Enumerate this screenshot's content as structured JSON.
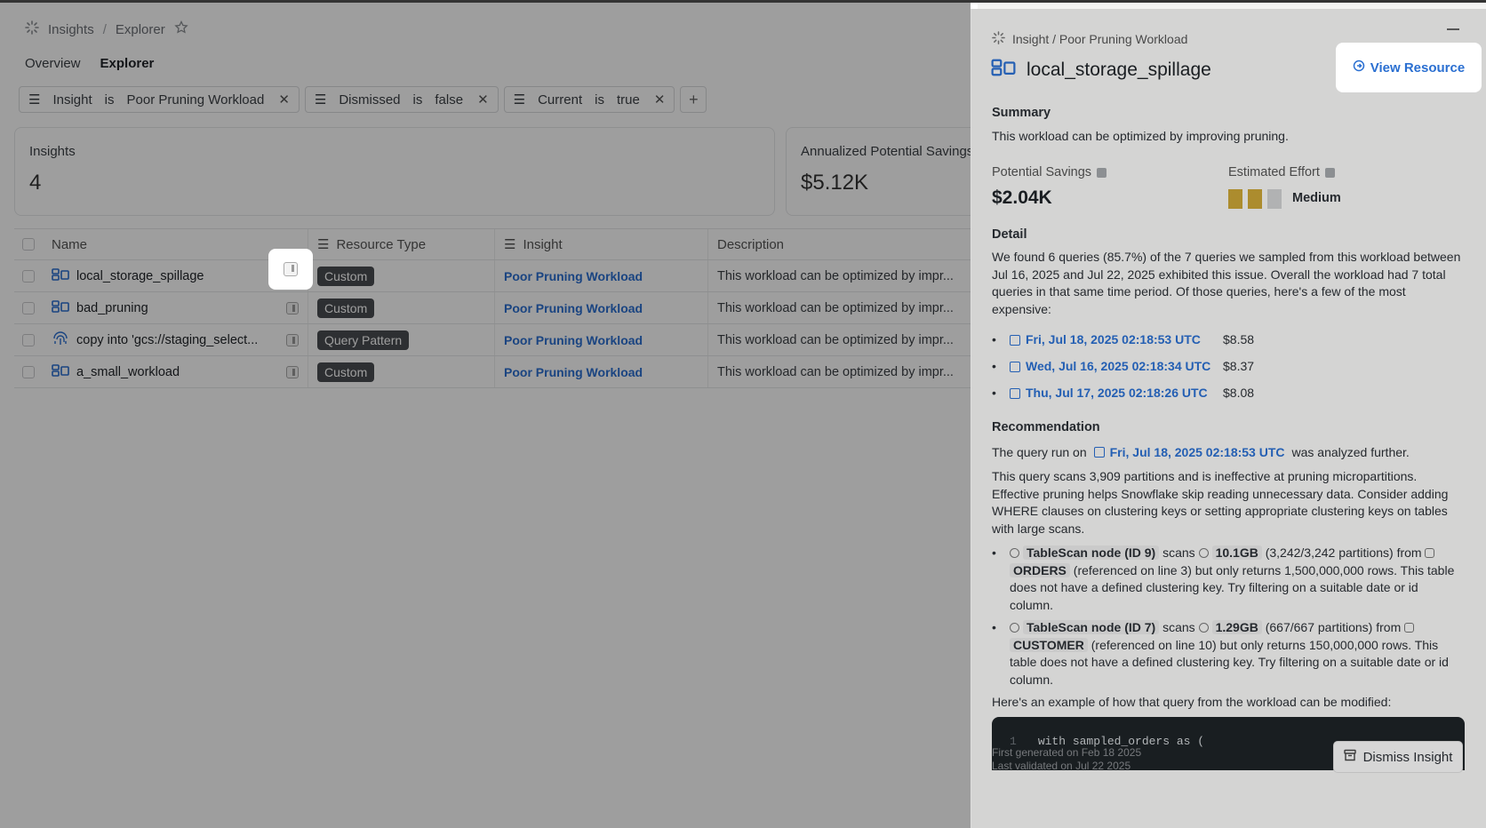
{
  "breadcrumb": {
    "root": "Insights",
    "current": "Explorer"
  },
  "tabs": [
    {
      "label": "Overview"
    },
    {
      "label": "Explorer"
    }
  ],
  "filters": [
    {
      "field": "Insight",
      "op": "is",
      "value": "Poor Pruning Workload"
    },
    {
      "field": "Dismissed",
      "op": "is",
      "value": "false"
    },
    {
      "field": "Current",
      "op": "is",
      "value": "true"
    }
  ],
  "cards": {
    "insights": {
      "label": "Insights",
      "value": "4"
    },
    "savings": {
      "label": "Annualized Potential Savings",
      "value": "$5.12K"
    }
  },
  "table": {
    "headers": {
      "name": "Name",
      "type": "Resource Type",
      "insight": "Insight",
      "desc": "Description"
    },
    "rows": [
      {
        "name": "local_storage_spillage",
        "type": "Custom",
        "insight": "Poor Pruning Workload",
        "desc": "This workload can be optimized by impr..."
      },
      {
        "name": "bad_pruning",
        "type": "Custom",
        "insight": "Poor Pruning Workload",
        "desc": "This workload can be optimized by impr..."
      },
      {
        "name": "copy into 'gcs://staging_select...",
        "type": "Query Pattern",
        "insight": "Poor Pruning Workload",
        "desc": "This workload can be optimized by impr..."
      },
      {
        "name": "a_small_workload",
        "type": "Custom",
        "insight": "Poor Pruning Workload",
        "desc": "This workload can be optimized by impr..."
      }
    ]
  },
  "drawer": {
    "breadcrumb": "Insight / Poor Pruning Workload",
    "title": "local_storage_spillage",
    "view_resource": "View Resource",
    "summary_h": "Summary",
    "summary": "This workload can be optimized by improving pruning.",
    "savings_label": "Potential Savings",
    "savings_value": "$2.04K",
    "effort_label": "Estimated Effort",
    "effort_value": "Medium",
    "effort_level": 2,
    "detail_h": "Detail",
    "detail": "We found 6 queries (85.7%) of the 7 queries we sampled from this workload between Jul 16, 2025 and Jul 22, 2025 exhibited this issue. Overall the workload had 7 total queries in that same time period. Of those queries, here's a few of the most expensive:",
    "queries": [
      {
        "time": "Fri, Jul 18, 2025 02:18:53 UTC",
        "cost": "$8.58"
      },
      {
        "time": "Wed, Jul 16, 2025 02:18:34 UTC",
        "cost": "$8.37"
      },
      {
        "time": "Thu, Jul 17, 2025 02:18:26 UTC",
        "cost": "$8.08"
      }
    ],
    "rec_h": "Recommendation",
    "rec_prefix": "The query run on",
    "rec_link": "Fri, Jul 18, 2025 02:18:53 UTC",
    "rec_suffix": "was analyzed further.",
    "rec_para": "This query scans 3,909 partitions and is ineffective at pruning micropartitions. Effective pruning helps Snowflake skip reading unnecessary data. Consider adding WHERE clauses on clustering keys or setting appropriate clustering keys on tables with large scans.",
    "scans": [
      {
        "node": "TableScan node (ID 9)",
        "scans": "scans",
        "size": "10.1GB",
        "parts": "(3,242/3,242 partitions) from",
        "table": "ORDERS",
        "rest": "(referenced on line 3) but only returns 1,500,000,000 rows. This table does not have a defined clustering key. Try filtering on a suitable date or id column."
      },
      {
        "node": "TableScan node (ID 7)",
        "scans": "scans",
        "size": "1.29GB",
        "parts": "(667/667 partitions) from",
        "table": "CUSTOMER",
        "rest": "(referenced on line 10) but only returns 150,000,000 rows. This table does not have a defined clustering key. Try filtering on a suitable date or id column."
      }
    ],
    "example_label": "Here's an example of how that query from the workload can be modified:",
    "code_line_no": "1",
    "code_line": "with sampled_orders as (",
    "first_generated": "First generated on Feb 18 2025",
    "last_validated": "Last validated on Jul 22 2025",
    "dismiss": "Dismiss Insight"
  }
}
